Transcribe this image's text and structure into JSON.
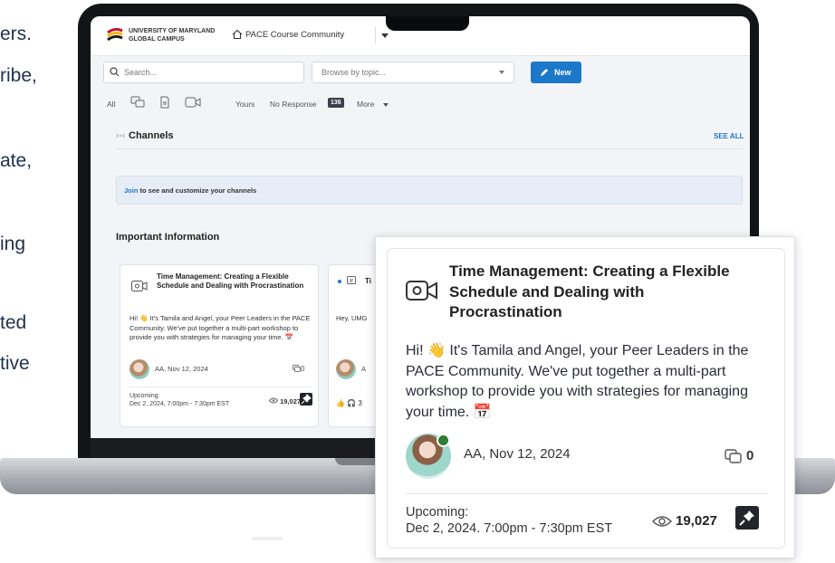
{
  "left_text": [
    "ers.",
    "ribe,",
    "ate,",
    "ing",
    "ted",
    "tive"
  ],
  "app": {
    "brand_line1": "UNIVERSITY OF MARYLAND",
    "brand_line2": "GLOBAL CAMPUS",
    "course": "PACE Course Community"
  },
  "toolbar": {
    "search_placeholder": "Search...",
    "browse_placeholder": "Browse by topic...",
    "new_label": "New"
  },
  "filters": {
    "all": "All",
    "yours": "Yours",
    "no_response": "No Response",
    "no_response_count": "136",
    "more": "More"
  },
  "channels": {
    "title": "Channels",
    "see_all": "SEE ALL",
    "join_link": "Join",
    "join_text": " to see and customize your channels"
  },
  "important": {
    "title": "Important Information"
  },
  "post": {
    "title": "Time Management: Creating a Flexible Schedule and Dealing with Procrastination",
    "body_small": "Hi! 👋 It's Tamila and Angel, your Peer Leaders in the PACE Community. We've put together a multi-part workshop to provide you with strategies for managing your time. 📅",
    "body_large": "Hi! 👋 It's Tamila and Angel, your Peer Leaders in the PACE Community. We've put together a multi-part workshop to provide you with strategies for managing your time. 📅",
    "author": "AA, Nov 12, 2024",
    "comments": "0",
    "upcoming_label": "Upcoming:",
    "upcoming_date_small": "Dec 2, 2024, 7:00pm - 7:30pm EST",
    "upcoming_date_large": "Dec 2, 2024. 7:00pm - 7:30pm EST",
    "views": "19,027"
  },
  "post2": {
    "title_frag": "Ti",
    "body_frag": "Hey, UMG",
    "author_frag": "A",
    "likes": "3"
  },
  "colors": {
    "accent": "#1c78c8",
    "brand_red": "#c8102e",
    "brand_gold": "#f2b900",
    "text_navy": "#1f3050"
  }
}
